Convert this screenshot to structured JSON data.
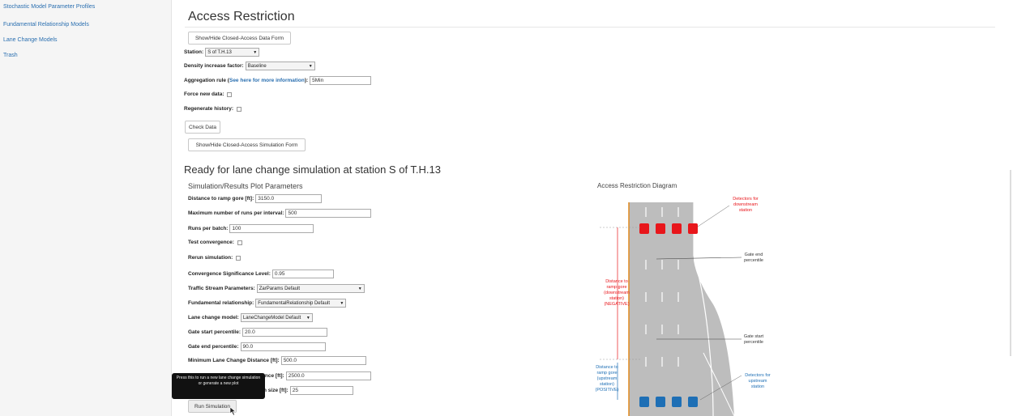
{
  "sidebar": {
    "items": [
      {
        "label": "Stochastic Model Parameter Profiles"
      },
      {
        "label": "Fundamental Relationship Models"
      },
      {
        "label": "Lane Change Models"
      },
      {
        "label": "Trash"
      }
    ]
  },
  "page_title": "Access Restriction",
  "data_form": {
    "toggle_button": "Show/Hide Closed-Access Data Form",
    "station_label": "Station:",
    "station_value": "S of T.H.13",
    "density_label": "Density increase factor:",
    "density_value": "Baseline",
    "aggregation_label_pre": "Aggregation rule (",
    "aggregation_link": "See here for more information",
    "aggregation_label_post": "):",
    "aggregation_value": "5Min",
    "force_label": "Force new data:",
    "regenerate_label": "Regenerate history:",
    "check_button": "Check Data",
    "sim_toggle_button": "Show/Hide Closed-Access Simulation Form"
  },
  "ready_heading": "Ready for lane change simulation at station S of T.H.13",
  "sim_form": {
    "heading": "Simulation/Results Plot Parameters",
    "fields": [
      {
        "label": "Distance to ramp gore [ft]:",
        "value": "3150.0"
      },
      {
        "label": "Maximum number of runs per interval:",
        "value": "500"
      },
      {
        "label": "Runs per batch:",
        "value": "100"
      },
      {
        "label": "Test convergence:"
      },
      {
        "label": "Rerun simulation:"
      },
      {
        "label": "Convergence Significance Level:",
        "value": "0.95"
      },
      {
        "label": "Traffic Stream Parameters:",
        "value": "ZarParams Default"
      },
      {
        "label": "Fundamental relationship:",
        "value": "FundamentalRelationship Default"
      },
      {
        "label": "Lane change model:",
        "value": "LaneChangeModel Default"
      },
      {
        "label": "Gate start percentile:",
        "value": "20.0"
      },
      {
        "label": "Gate end percentile:",
        "value": "90.0"
      },
      {
        "label": "Minimum Lane Change Distance [ft]:",
        "value": "500.0"
      },
      {
        "label": "Distance [ft]:",
        "value": "2500.0"
      },
      {
        "label": "n size [ft]:",
        "value": "25"
      }
    ],
    "run_button": "Run Simulation",
    "tooltip": "Press this to run a new lane change simulation or generate a new plot"
  },
  "diagram": {
    "heading": "Access Restriction Diagram",
    "det_down": [
      "Detectors for",
      "downstream",
      "station"
    ],
    "gate_end": [
      "Gate end",
      "percentile"
    ],
    "dist_down": [
      "Distance to",
      "ramp gore",
      "(downstream",
      "station)",
      "(NEGATIVE)"
    ],
    "gate_start": [
      "Gate start",
      "percentile"
    ],
    "dist_up": [
      "Distance to",
      "ramp gore",
      "(upstream",
      "station)",
      "(POSITIVE)"
    ],
    "det_up": [
      "Detectors for",
      "upstream",
      "station"
    ],
    "colors": {
      "red": "#e8161b",
      "blue": "#1e6fb5",
      "road": "#bdbdbd"
    }
  }
}
